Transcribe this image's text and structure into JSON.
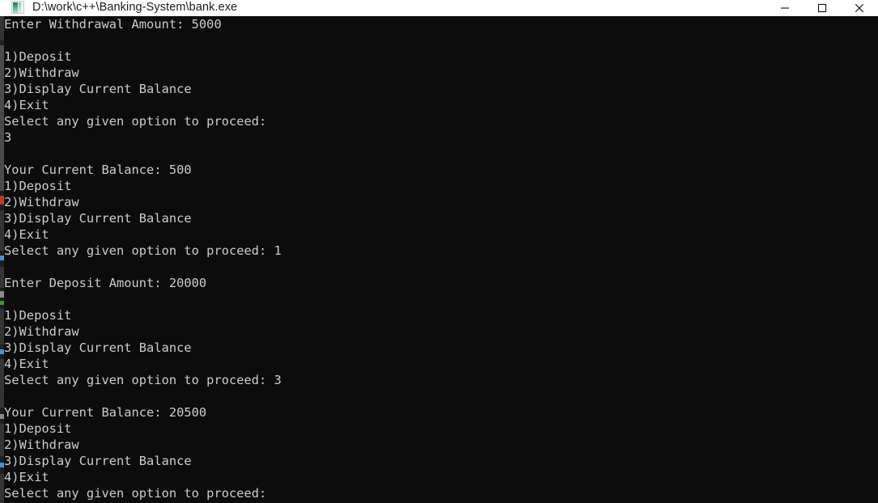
{
  "window": {
    "title": "D:\\work\\c++\\Banking-System\\bank.exe",
    "icon": "console-app-icon",
    "titlebar_bg": "#ffffff",
    "titlebar_text_color": "#1b1b1b",
    "controls": [
      {
        "name": "minimize",
        "glyph": "minimize-icon",
        "label": "Minimize"
      },
      {
        "name": "maximize",
        "glyph": "maximize-icon",
        "label": "Maximize"
      },
      {
        "name": "close",
        "glyph": "close-icon",
        "label": "Close"
      }
    ]
  },
  "console": {
    "background": "#0c0c0c",
    "foreground": "#cccccc",
    "font_size_px": 15.4,
    "line_height_px": 20,
    "lines": [
      "Enter Withdrawal Amount: 5000",
      "",
      "1)Deposit",
      "2)Withdraw",
      "3)Display Current Balance",
      "4)Exit",
      "Select any given option to proceed:",
      "3",
      "",
      "Your Current Balance: 500",
      "1)Deposit",
      "2)Withdraw",
      "3)Display Current Balance",
      "4)Exit",
      "Select any given option to proceed: 1",
      "",
      "Enter Deposit Amount: 20000",
      "",
      "1)Deposit",
      "2)Withdraw",
      "3)Display Current Balance",
      "4)Exit",
      "Select any given option to proceed: 3",
      "",
      "Your Current Balance: 20500",
      "1)Deposit",
      "2)Withdraw",
      "3)Display Current Balance",
      "4)Exit",
      "Select any given option to proceed:"
    ]
  },
  "edge_scrollbar": {
    "description": "thin scrollbar/minimap sliver of background editor window at left edge",
    "track_color": "#1e1e1e",
    "thumb_color": "#4a4a4a",
    "marker_blue": "#4a8fd4",
    "marker_red": "#c0392b",
    "marker_green": "#4e8a3f"
  }
}
